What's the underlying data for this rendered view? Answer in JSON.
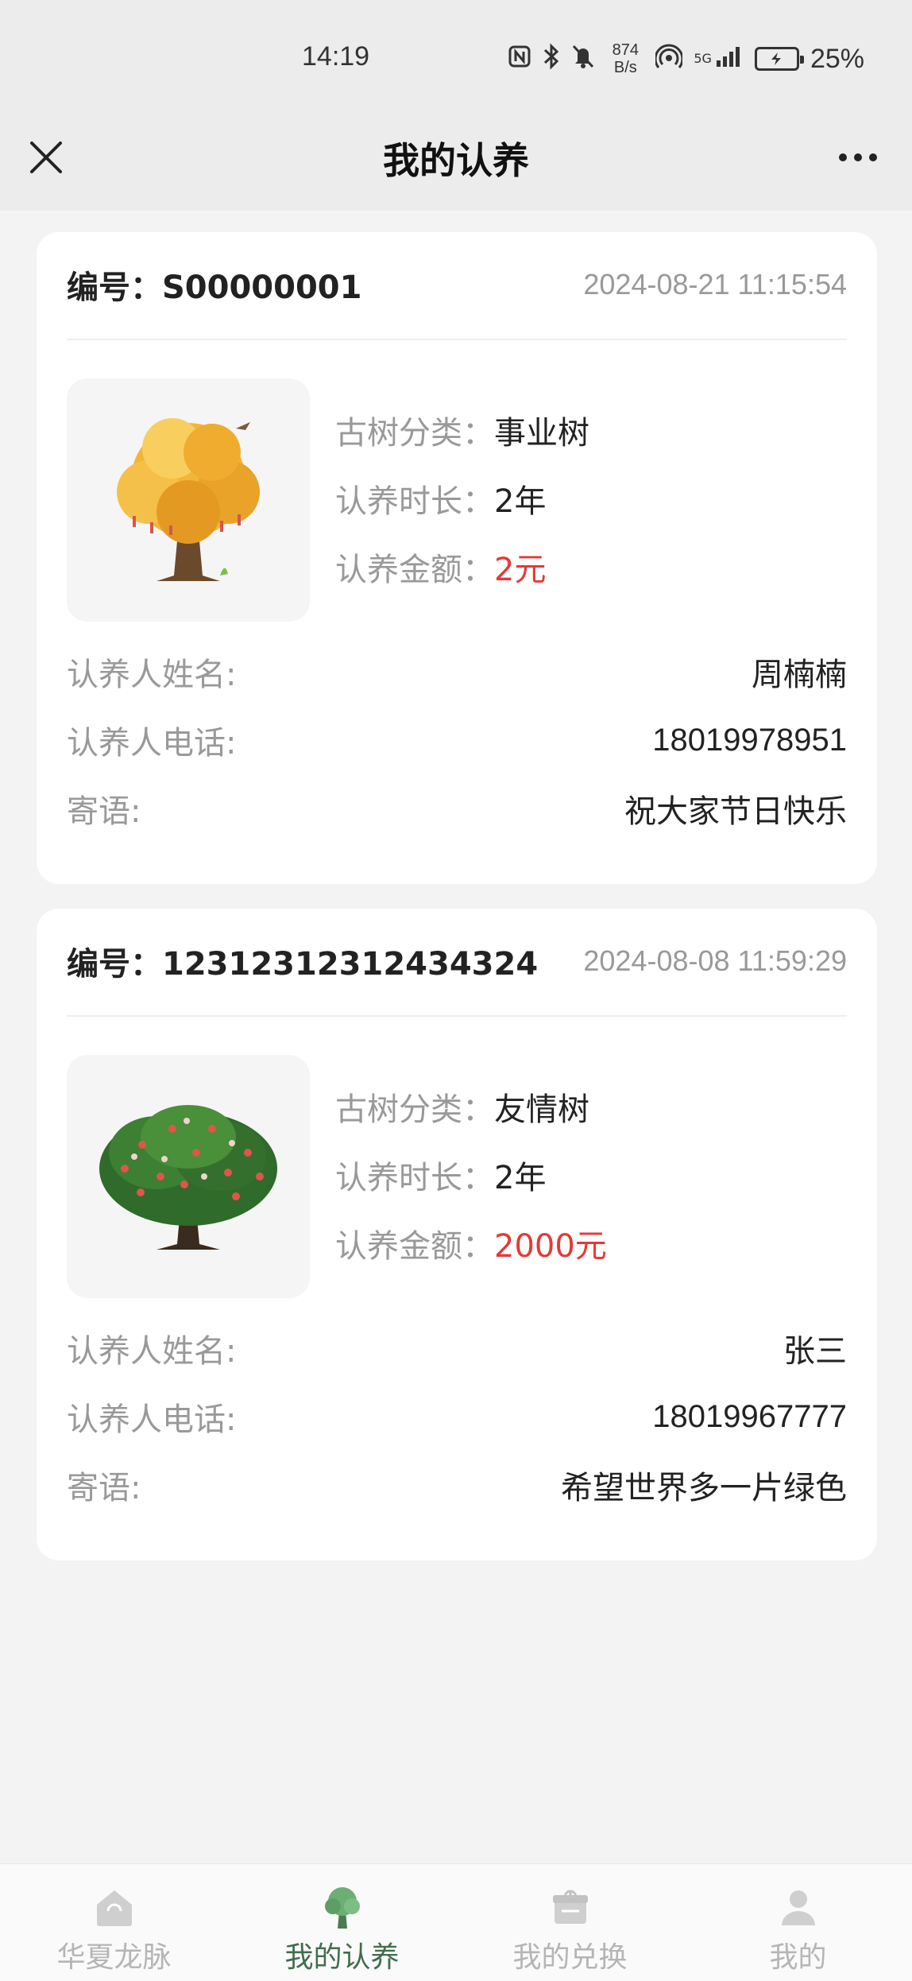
{
  "status_bar": {
    "time": "14:19",
    "net_speed_value": "874",
    "net_speed_unit": "B/s",
    "signal_label": "5G",
    "battery_pct": "25%",
    "icons": [
      "nfc-icon",
      "bluetooth-icon",
      "mute-icon",
      "hotspot-icon",
      "signal-icon",
      "battery-icon"
    ]
  },
  "nav": {
    "title": "我的认养",
    "close_icon": "close-icon",
    "more_icon": "more-icon"
  },
  "labels": {
    "code_prefix": "编号：",
    "category": "古树分类：",
    "duration": "认养时长：",
    "amount": "认养金额：",
    "adopter_name": "认养人姓名:",
    "adopter_phone": "认养人电话:",
    "message": "寄语:"
  },
  "records": [
    {
      "code": "S00000001",
      "date": "2024-08-21 11:15:54",
      "category": "事业树",
      "duration": "2年",
      "amount": "2元",
      "adopter_name": "周楠楠",
      "adopter_phone": "18019978951",
      "message": "祝大家节日快乐",
      "image_icon": "golden-tree-image"
    },
    {
      "code": "12312312312434324",
      "date": "2024-08-08 11:59:29",
      "category": "友情树",
      "duration": "2年",
      "amount": "2000元",
      "adopter_name": "张三",
      "adopter_phone": "18019967777",
      "message": "希望世界多一片绿色",
      "image_icon": "green-fruit-tree-image"
    }
  ],
  "tabs": [
    {
      "label": "华夏龙脉",
      "icon": "home-icon",
      "active": false
    },
    {
      "label": "我的认养",
      "icon": "tree-icon",
      "active": true
    },
    {
      "label": "我的兑换",
      "icon": "gift-icon",
      "active": false
    },
    {
      "label": "我的",
      "icon": "user-icon",
      "active": false
    }
  ],
  "colors": {
    "accent": "#3f6e4b",
    "money": "#e53935",
    "background": "#f3f3f3"
  }
}
